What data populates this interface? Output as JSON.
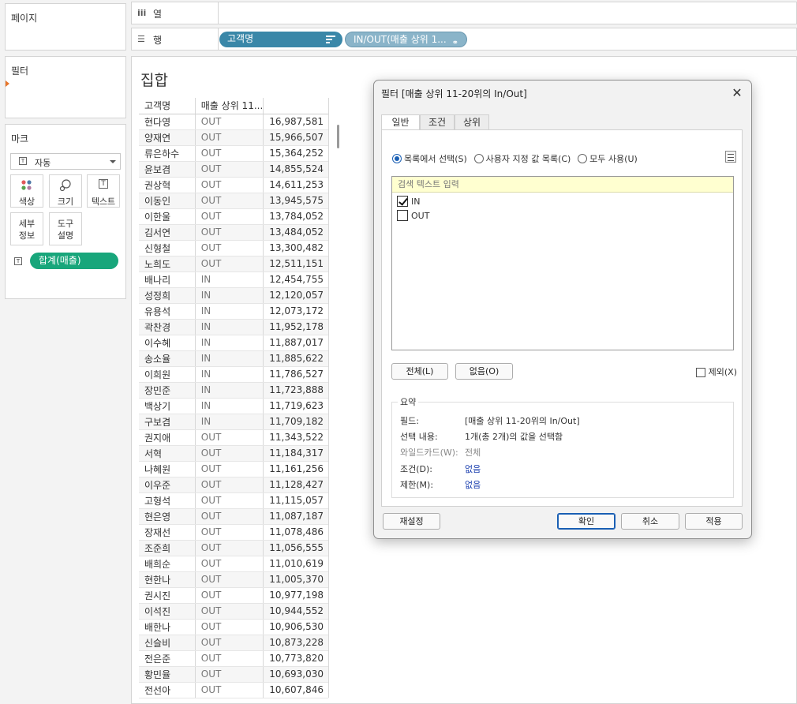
{
  "left_panel": {
    "pages_title": "페이지",
    "filters_title": "필터",
    "marks_title": "마크",
    "mark_type": "자동",
    "buttons": {
      "color": "색상",
      "size": "크기",
      "text": "텍스트",
      "detail_line1": "세부",
      "detail_line2": "정보",
      "tooltip_line1": "도구",
      "tooltip_line2": "설명"
    },
    "measure_pill": "합계(매출)"
  },
  "shelves": {
    "columns_label": "열",
    "rows_label": "행",
    "row_pills": [
      "고객명",
      "IN/OUT(매출 상위 1..."
    ]
  },
  "view": {
    "title": "집합",
    "headers": [
      "고객명",
      "매출 상위 11..."
    ],
    "rows": [
      [
        "현다영",
        "OUT",
        "16,987,581"
      ],
      [
        "양재연",
        "OUT",
        "15,966,507"
      ],
      [
        "류은하수",
        "OUT",
        "15,364,252"
      ],
      [
        "윤보겸",
        "OUT",
        "14,855,524"
      ],
      [
        "권상혁",
        "OUT",
        "14,611,253"
      ],
      [
        "이동인",
        "OUT",
        "13,945,575"
      ],
      [
        "이한울",
        "OUT",
        "13,784,052"
      ],
      [
        "김서연",
        "OUT",
        "13,484,052"
      ],
      [
        "신형철",
        "OUT",
        "13,300,482"
      ],
      [
        "노희도",
        "OUT",
        "12,511,151"
      ],
      [
        "배나리",
        "IN",
        "12,454,755"
      ],
      [
        "성정희",
        "IN",
        "12,120,057"
      ],
      [
        "유용석",
        "IN",
        "12,073,172"
      ],
      [
        "곽찬경",
        "IN",
        "11,952,178"
      ],
      [
        "이수혜",
        "IN",
        "11,887,017"
      ],
      [
        "송소율",
        "IN",
        "11,885,622"
      ],
      [
        "이희원",
        "IN",
        "11,786,527"
      ],
      [
        "장민준",
        "IN",
        "11,723,888"
      ],
      [
        "백상기",
        "IN",
        "11,719,623"
      ],
      [
        "구보겸",
        "IN",
        "11,709,182"
      ],
      [
        "권지애",
        "OUT",
        "11,343,522"
      ],
      [
        "서혁",
        "OUT",
        "11,184,317"
      ],
      [
        "나혜원",
        "OUT",
        "11,161,256"
      ],
      [
        "이우준",
        "OUT",
        "11,128,427"
      ],
      [
        "고형석",
        "OUT",
        "11,115,057"
      ],
      [
        "현은영",
        "OUT",
        "11,087,187"
      ],
      [
        "장재선",
        "OUT",
        "11,078,486"
      ],
      [
        "조준희",
        "OUT",
        "11,056,555"
      ],
      [
        "배희순",
        "OUT",
        "11,010,619"
      ],
      [
        "현한나",
        "OUT",
        "11,005,370"
      ],
      [
        "권시진",
        "OUT",
        "10,977,198"
      ],
      [
        "이석진",
        "OUT",
        "10,944,552"
      ],
      [
        "배한나",
        "OUT",
        "10,906,530"
      ],
      [
        "신슬비",
        "OUT",
        "10,873,228"
      ],
      [
        "전은준",
        "OUT",
        "10,773,820"
      ],
      [
        "황민율",
        "OUT",
        "10,693,030"
      ],
      [
        "전선아",
        "OUT",
        "10,607,846"
      ]
    ]
  },
  "dialog": {
    "title": "필터 [매출 상위 11-20위의 In/Out]",
    "tabs": [
      "일반",
      "조건",
      "상위"
    ],
    "radio": [
      "목록에서 선택(S)",
      "사용자 지정 값 목록(C)",
      "모두 사용(U)"
    ],
    "search_placeholder": "검색 텍스트 입력",
    "items": [
      {
        "label": "IN",
        "checked": true
      },
      {
        "label": "OUT",
        "checked": false
      }
    ],
    "btn_all": "전체(L)",
    "btn_none": "없음(O)",
    "exclude_label": "제외(X)",
    "summary_title": "요약",
    "summary": {
      "field_k": "필드:",
      "field_v": "[매출 상위 11-20위의 In/Out]",
      "selection_k": "선택 내용:",
      "selection_v": "1개(총 2개)의 값을 선택함",
      "wildcard_k": "와일드카드(W):",
      "wildcard_v": "전체",
      "condition_k": "조건(D):",
      "condition_v": "없음",
      "limit_k": "제한(M):",
      "limit_v": "없음"
    },
    "btn_reset": "재설정",
    "btn_ok": "확인",
    "btn_cancel": "취소",
    "btn_apply": "적용"
  }
}
